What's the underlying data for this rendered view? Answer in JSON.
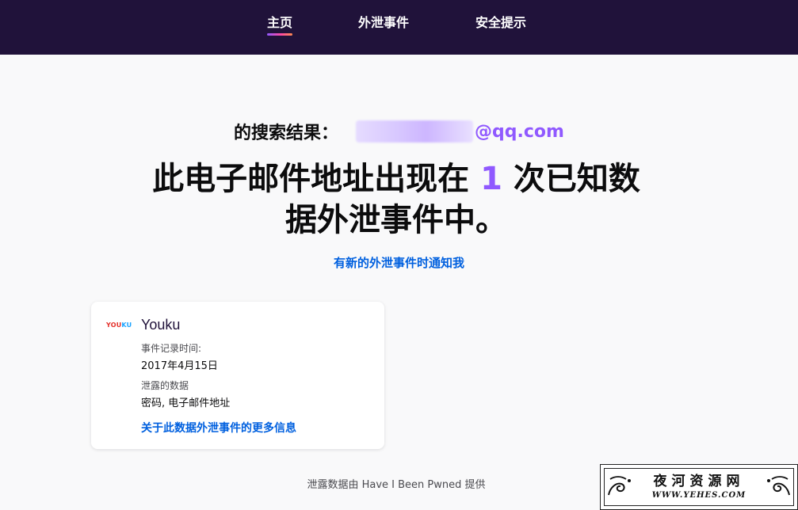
{
  "nav": {
    "items": [
      {
        "label": "主页",
        "active": true
      },
      {
        "label": "外泄事件",
        "active": false
      },
      {
        "label": "安全提示",
        "active": false
      }
    ]
  },
  "search": {
    "prefix": "的搜索结果：",
    "email_visible": "@qq.com"
  },
  "headline": {
    "before": "此电子邮件地址出现在 ",
    "count": "1",
    "after": " 次已知数据外泄事件中。"
  },
  "notify_link": "有新的外泄事件时通知我",
  "breach": {
    "logo_you": "YOU",
    "logo_ku": "KU",
    "name": "Youku",
    "added_label": "事件记录时间:",
    "added_value": "2017年4月15日",
    "data_label": "泄露的数据",
    "data_value": "密码, 电子邮件地址",
    "more_link": "关于此数据外泄事件的更多信息"
  },
  "footer": "泄露数据由 Have I Been Pwned 提供",
  "watermark": {
    "title": "夜河资源网",
    "url": "WWW.YEHES.COM"
  },
  "colors": {
    "nav_bg": "#20123a",
    "accent_purple": "#9059ff",
    "link_blue": "#0060df",
    "page_bg": "#f9f9fa"
  }
}
